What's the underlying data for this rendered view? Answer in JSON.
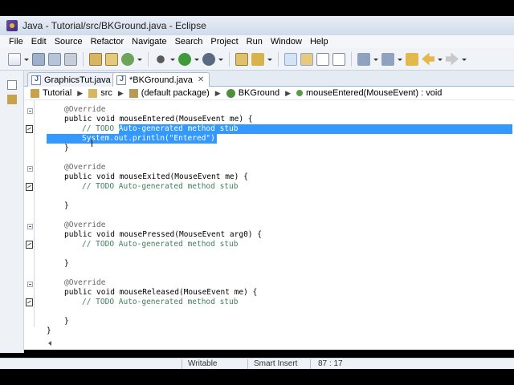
{
  "window": {
    "title": "Java - Tutorial/src/BKGround.java - Eclipse"
  },
  "menu": [
    "File",
    "Edit",
    "Source",
    "Refactor",
    "Navigate",
    "Search",
    "Project",
    "Run",
    "Window",
    "Help"
  ],
  "toolbar": {
    "icons": [
      "new-icon",
      "save-icon",
      "save-all-icon",
      "print-icon",
      "open-type-icon",
      "new-package-icon",
      "new-class-icon",
      "debug-icon",
      "run-icon",
      "external-tools-icon",
      "open-perspective-icon",
      "search-icon",
      "toggle-mark-occurrences-icon",
      "toggle-highlight-icon",
      "show-whitespace-icon",
      "next-annotation-icon",
      "previous-annotation-icon",
      "back-icon",
      "forward-icon"
    ]
  },
  "tabs": [
    {
      "label": "GraphicsTut.java",
      "active": false
    },
    {
      "label": "*BKGround.java",
      "active": true,
      "close": "✕"
    }
  ],
  "breadcrumb": [
    "Tutorial",
    "src",
    "(default package)",
    "BKGround",
    "mouseEntered(MouseEvent) : void"
  ],
  "code": {
    "l1": "@Override",
    "l2_kw": "public void",
    "l2_rest": " mouseEntered(MouseEvent me) {",
    "l3_pre": "// TODO ",
    "l3_sel": "Auto-generated method stub",
    "l4": "System.out.println(\"Entered\");",
    "l5": "}",
    "l6": "@Override",
    "l7_kw": "public void",
    "l7_rest": " mouseExited(MouseEvent me) {",
    "l8": "// TODO Auto-generated method stub",
    "l9": "}",
    "l10": "@Override",
    "l11_kw": "public void",
    "l11_rest": " mousePressed(MouseEvent arg0) {",
    "l12": "// TODO Auto-generated method stub",
    "l13": "}",
    "l14": "@Override",
    "l15_kw": "public void",
    "l15_rest": " mouseReleased(MouseEvent me) {",
    "l16": "// TODO Auto-generated method stub",
    "l17": "}",
    "l18": "}"
  },
  "status": {
    "writable": "Writable",
    "insert": "Smart Insert",
    "position": "87 : 17"
  },
  "colors": {
    "selection": "#3399ff",
    "comment": "#3f7f5f",
    "annotation": "#646464"
  }
}
